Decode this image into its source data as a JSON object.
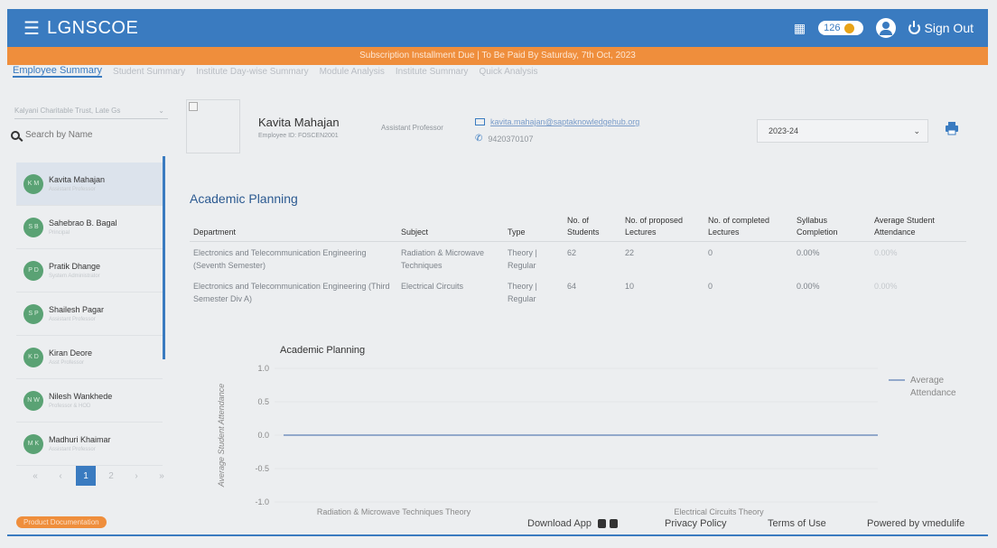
{
  "header": {
    "brand": "LGNSCOE",
    "coins": "126",
    "signout_label": "Sign Out"
  },
  "notice": "Subscription Installment Due | To Be Paid By Saturday, 7th Oct, 2023",
  "tabs": [
    {
      "label": "Employee Summary",
      "active": true
    },
    {
      "label": "Student Summary"
    },
    {
      "label": "Institute Day-wise Summary"
    },
    {
      "label": "Module Analysis"
    },
    {
      "label": "Institute Summary"
    },
    {
      "label": "Quick Analysis"
    }
  ],
  "sidebar": {
    "institute": "Kalyani Charitable Trust, Late Gs",
    "search_placeholder": "Search by Name",
    "employees": [
      {
        "initials": "K M",
        "name": "Kavita Mahajan",
        "role": "Assistant Professor",
        "selected": true
      },
      {
        "initials": "S B",
        "name": "Sahebrao B. Bagal",
        "role": "Principal"
      },
      {
        "initials": "P D",
        "name": "Pratik Dhange",
        "role": "System Administrator"
      },
      {
        "initials": "S P",
        "name": "Shailesh Pagar",
        "role": "Assistant Professor"
      },
      {
        "initials": "K D",
        "name": "Kiran Deore",
        "role": "Asst Professor"
      },
      {
        "initials": "N W",
        "name": "Nilesh Wankhede",
        "role": "Professor & HOD"
      },
      {
        "initials": "M K",
        "name": "Madhuri Khaimar",
        "role": "Assistant Professor"
      }
    ],
    "pager": {
      "prev2": "«",
      "prev": "‹",
      "pages": [
        "1",
        "2"
      ],
      "next": "›",
      "next2": "»"
    }
  },
  "profile": {
    "name": "Kavita Mahajan",
    "employee_id": "Employee ID: FOSCEN2001",
    "designation": "Assistant Professor",
    "email": "kavita.mahajan@saptaknowledgehub.org",
    "phone": "9420370107",
    "year": "2023-24"
  },
  "academic_planning": {
    "title": "Academic Planning",
    "columns": [
      "Department",
      "Subject",
      "Type",
      "No. of Students",
      "No. of proposed Lectures",
      "No. of completed Lectures",
      "Syllabus Completion",
      "Average Student Attendance"
    ],
    "rows": [
      [
        "Electronics and Telecommunication Engineering (Seventh Semester)",
        "Radiation & Microwave Techniques",
        "Theory | Regular",
        "62",
        "22",
        "0",
        "0.00%",
        "0.00%"
      ],
      [
        "Electronics and Telecommunication Engineering (Third Semester Div A)",
        "Electrical Circuits",
        "Theory | Regular",
        "64",
        "10",
        "0",
        "0.00%",
        "0.00%"
      ]
    ]
  },
  "chart_data": {
    "type": "line",
    "title": "Academic Planning",
    "ylabel": "Average Student Attendance",
    "xlabel": "",
    "categories": [
      "Radiation & Microwave Techniques Theory",
      "Electrical Circuits Theory"
    ],
    "yticks": [
      "1.0",
      "0.5",
      "0.0",
      "-0.5",
      "-1.0"
    ],
    "ylim": [
      -1,
      1
    ],
    "grid": true,
    "legend_position": "right",
    "series": [
      {
        "name": "Average Attendance",
        "values": [
          0,
          0
        ],
        "color": "#5b7fb5"
      }
    ]
  },
  "footer": {
    "doc_button": "Product Documentation",
    "download_app": "Download App",
    "privacy": "Privacy Policy",
    "terms": "Terms of Use",
    "powered": "Powered by vmedulife"
  },
  "colors": {
    "primary": "#3a7bc0",
    "accent": "#ef8e3c",
    "avatar": "#5aa274"
  }
}
